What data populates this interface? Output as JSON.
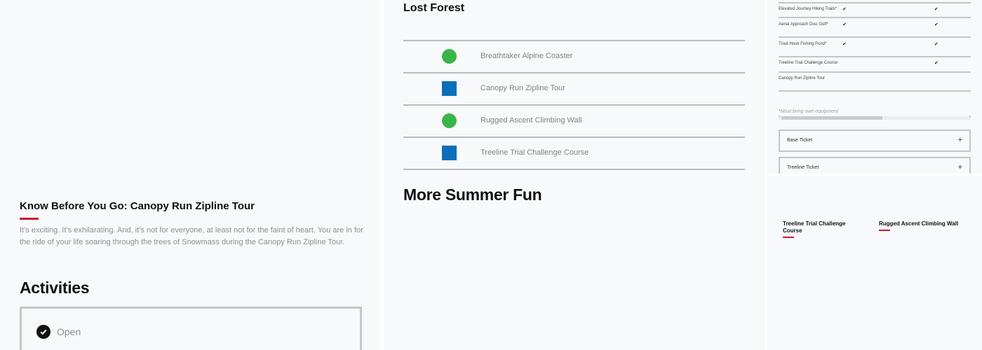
{
  "left": {
    "kbyg_title": "Know Before You Go: Canopy Run Zipline Tour",
    "kbyg_body": "It’s exciting. It’s exhilarating. And, it’s not for everyone, at least not for the faint of heart. You are in for the ride of your life soaring through the trees of Snowmass during the Canopy Run Zipline Tour.",
    "activities_title": "Activities",
    "status_label": "Open"
  },
  "middle": {
    "lost_forest_title": "Lost Forest",
    "activities": [
      {
        "name": "Breathtaker Alpine Coaster",
        "icon": "green-circle"
      },
      {
        "name": "Canopy Run Zipline Tour",
        "icon": "blue-square"
      },
      {
        "name": "Rugged Ascent Climbing Wall",
        "icon": "green-circle"
      },
      {
        "name": "Treeline Trial Challenge Course",
        "icon": "blue-square"
      }
    ],
    "more_fun_title": "More Summer Fun"
  },
  "right_top": {
    "rows": [
      {
        "name": "Elevated Journey Hiking Trails*",
        "col1": "✔",
        "col2": "✔"
      },
      {
        "name": "Aerial Approach Disc Golf*",
        "col1": "✔",
        "col2": "✔"
      },
      {
        "name": "Trout Hook Fishing Pond*",
        "col1": "✔",
        "col2": "✔"
      },
      {
        "name": "Treeline Trial Challenge Course",
        "col1": "",
        "col2": "✔"
      },
      {
        "name": "Canopy Run Zipline Tour",
        "col1": "",
        "col2": ""
      }
    ],
    "note": "*Must bring own equipment",
    "tickets": [
      {
        "label": "Base Ticket",
        "toggle": "+"
      },
      {
        "label": "Treeline Ticket",
        "toggle": "+"
      }
    ]
  },
  "right_bottom": {
    "cards": [
      {
        "title": "Treeline Trial Challenge Course"
      },
      {
        "title": "Rugged Ascent Climbing Wall"
      }
    ]
  },
  "colors": {
    "accent_red": "#d0142c",
    "icon_green": "#3ab54a",
    "icon_blue": "#0b6fba"
  }
}
